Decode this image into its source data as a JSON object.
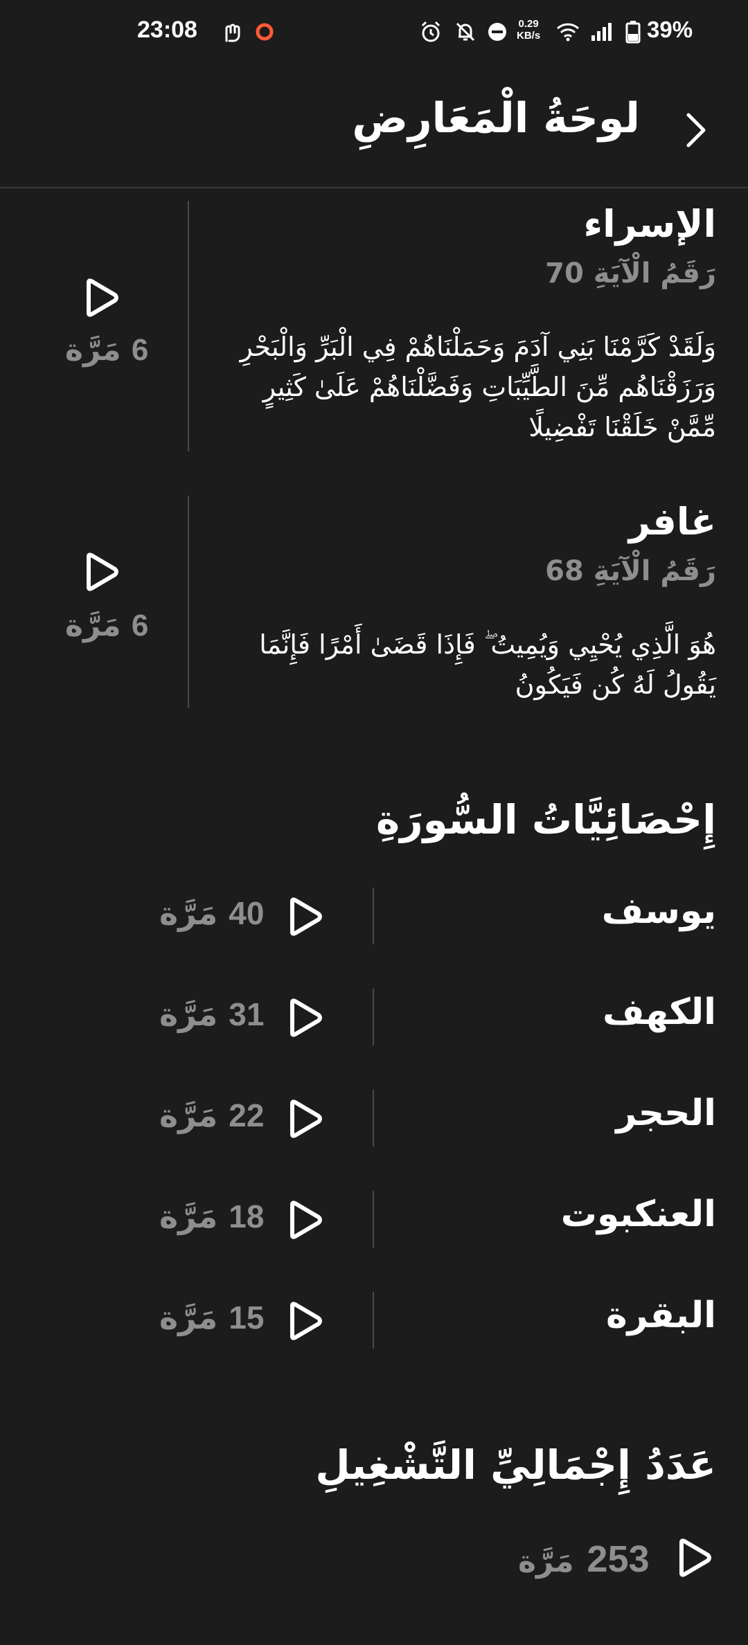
{
  "status_bar": {
    "time": "23:08",
    "speed_value": "0.29",
    "speed_unit": "KB/s",
    "battery": "39%",
    "icons": [
      "hand-icon",
      "record-icon",
      "alarm-icon",
      "mute-icon",
      "dnd-icon",
      "wifi-icon",
      "signal-icon",
      "battery-icon"
    ]
  },
  "header": {
    "title": "لوحَةُ الْمَعَارِضِ",
    "back_icon": "chevron-right-icon"
  },
  "verses": [
    {
      "surah": "الإسراء",
      "ayah_label": "رَقَمُ الْآيَةِ 70",
      "text": "وَلَقَدْ كَرَّمْنَا بَنِي آدَمَ وَحَمَلْنَاهُمْ فِي الْبَرِّ وَالْبَحْرِ وَرَزَقْنَاهُم مِّنَ الطَّيِّبَاتِ وَفَضَّلْنَاهُمْ عَلَىٰ كَثِيرٍ مِّمَّنْ خَلَقْنَا تَفْضِيلًا",
      "count_number": "6",
      "count_unit": "مَرَّة"
    },
    {
      "surah": "غافر",
      "ayah_label": "رَقَمُ الْآيَةِ 68",
      "text": "هُوَ الَّذِي يُحْيِي وَيُمِيتُ ۖ فَإِذَا قَضَىٰ أَمْرًا فَإِنَّمَا يَقُولُ لَهُ كُن فَيَكُونُ",
      "count_number": "6",
      "count_unit": "مَرَّة"
    }
  ],
  "surah_stats": {
    "title": "إِحْصَائِيَّاتُ السُّورَةِ",
    "items": [
      {
        "name": "يوسف",
        "count": "40",
        "unit": "مَرَّة"
      },
      {
        "name": "الكهف",
        "count": "31",
        "unit": "مَرَّة"
      },
      {
        "name": "الحجر",
        "count": "22",
        "unit": "مَرَّة"
      },
      {
        "name": "العنكبوت",
        "count": "18",
        "unit": "مَرَّة"
      },
      {
        "name": "البقرة",
        "count": "15",
        "unit": "مَرَّة"
      }
    ]
  },
  "total": {
    "title": "عَدَدُ إِجْمَالِيِّ التَّشْغِيلِ",
    "count": "253",
    "unit": "مَرَّة"
  }
}
